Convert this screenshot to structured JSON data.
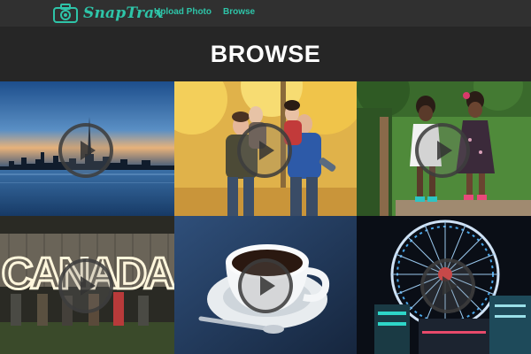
{
  "brand": {
    "name": "SnapTrax",
    "accent": "#2ec4a8"
  },
  "nav": {
    "upload_label": "Upload Photo",
    "browse_label": "Browse"
  },
  "header": {
    "title": "BROWSE"
  },
  "tiles": [
    {
      "subject": "city skyline at sunset over water",
      "icon": "play-icon"
    },
    {
      "subject": "couples piggyback in autumn park",
      "icon": "play-icon"
    },
    {
      "subject": "two girls walking on park path",
      "icon": "play-icon"
    },
    {
      "subject": "sparkler lettering CANADA",
      "sparkler_text": "CANADA",
      "icon": "play-icon"
    },
    {
      "subject": "coffee cup on saucer",
      "icon": "play-icon"
    },
    {
      "subject": "illuminated ferris wheel at night",
      "icon": "play-icon"
    }
  ]
}
